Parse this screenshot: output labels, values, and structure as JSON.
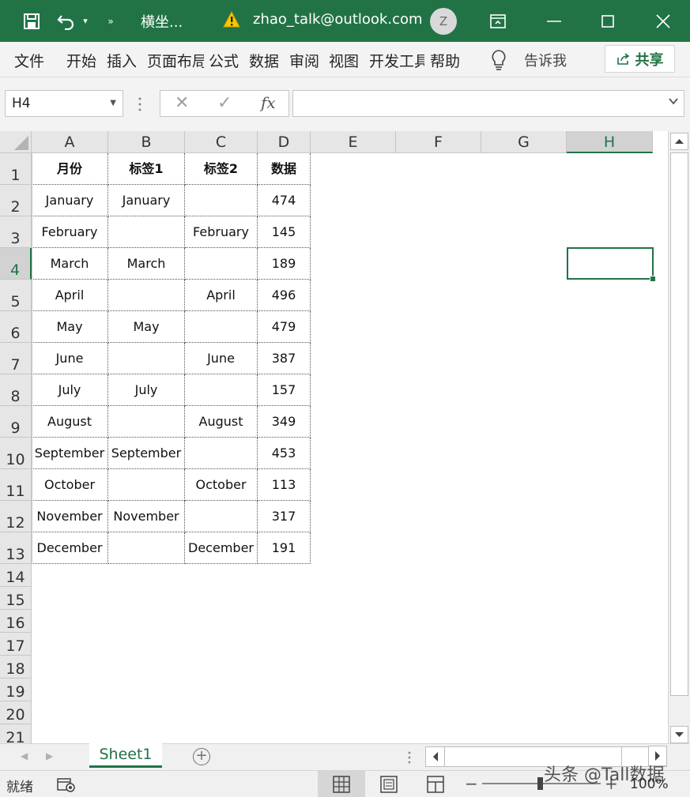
{
  "titlebar": {
    "doc_title": "横坐...",
    "account": "zhao_talk@outlook.com",
    "avatar_letter": "Z"
  },
  "ribbon": {
    "tabs": [
      "文件",
      "开始",
      "插入",
      "页面布局",
      "公式",
      "数据",
      "审阅",
      "视图",
      "开发工具",
      "帮助"
    ],
    "tell_me": "告诉我",
    "share": "共享"
  },
  "formula_bar": {
    "name_box": "H4",
    "fx_label": "fx",
    "formula": ""
  },
  "sheet": {
    "columns": [
      "A",
      "B",
      "C",
      "D",
      "E",
      "F",
      "G",
      "H"
    ],
    "selected_column": "H",
    "rows": [
      "1",
      "2",
      "3",
      "4",
      "5",
      "6",
      "7",
      "8",
      "9",
      "10",
      "11",
      "12",
      "13",
      "14",
      "15",
      "16",
      "17",
      "18",
      "19",
      "20",
      "21"
    ],
    "selected_row": "4",
    "header": [
      "月份",
      "标签1",
      "标签2",
      "数据"
    ],
    "data": [
      [
        "January",
        "January",
        "",
        "474"
      ],
      [
        "February",
        "",
        "February",
        "145"
      ],
      [
        "March",
        "March",
        "",
        "189"
      ],
      [
        "April",
        "",
        "April",
        "496"
      ],
      [
        "May",
        "May",
        "",
        "479"
      ],
      [
        "June",
        "",
        "June",
        "387"
      ],
      [
        "July",
        "July",
        "",
        "157"
      ],
      [
        "August",
        "",
        "August",
        "349"
      ],
      [
        "September",
        "September",
        "",
        "453"
      ],
      [
        "October",
        "",
        "October",
        "113"
      ],
      [
        "November",
        "November",
        "",
        "317"
      ],
      [
        "December",
        "",
        "December",
        "191"
      ]
    ]
  },
  "sheet_tabs": {
    "active": "Sheet1"
  },
  "status": {
    "ready": "就绪",
    "zoom": "100%"
  },
  "watermark": "头条 @Tall数据",
  "colors": {
    "brand": "#217346",
    "ribbon_bg": "#f3f3f3",
    "header_bg": "#e6e6e6"
  }
}
